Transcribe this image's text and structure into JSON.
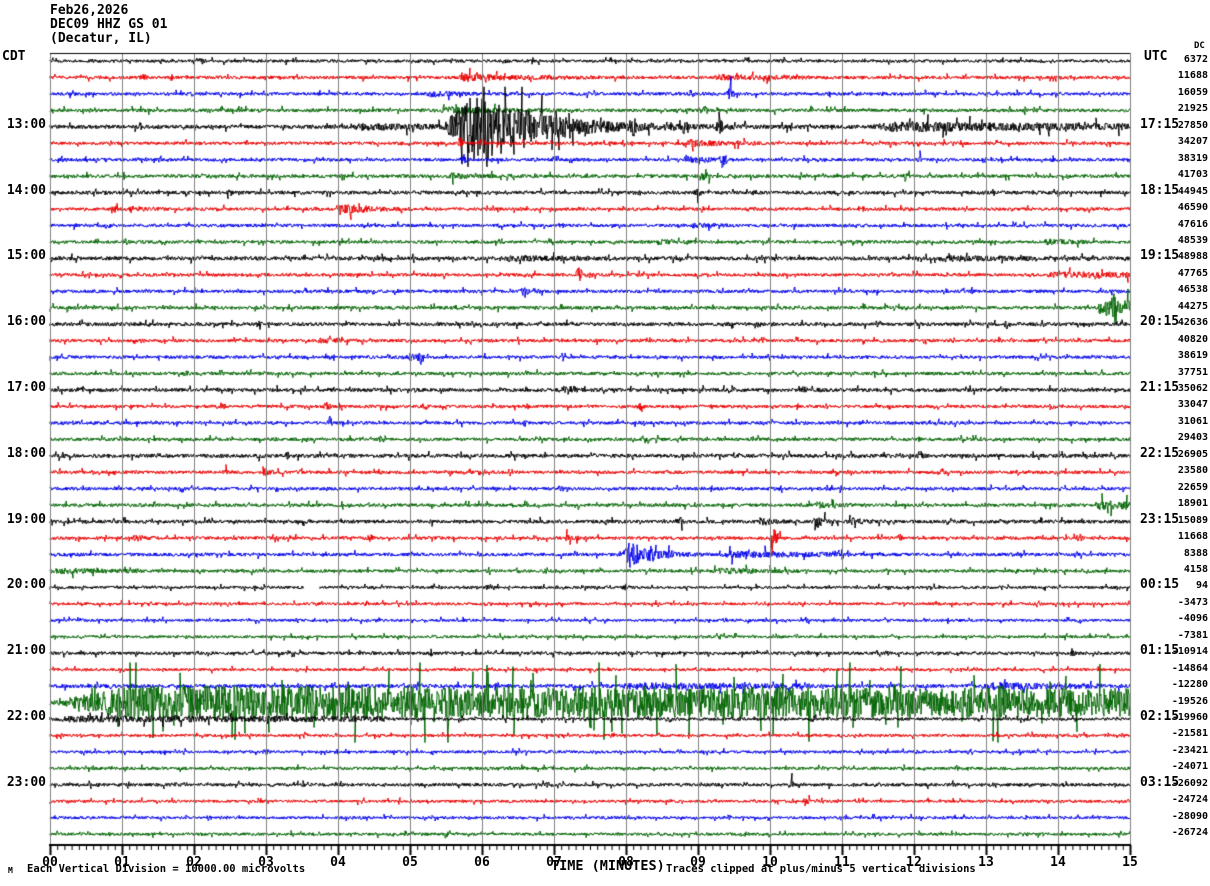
{
  "header": {
    "date": "Feb26,2026",
    "station": "DEC09 HHZ GS 01",
    "location": "(Decatur, IL)",
    "left_tz_label": "CDT",
    "right_tz_label": "UTC",
    "dc_column_header": "DC"
  },
  "footer": {
    "corner_glyph": "M",
    "scale_note": "Each Vertical Division = 10000.00 microvolts",
    "clip_note": "Traces clipped at plus/minus 5 vertical divisions"
  },
  "chart_data": {
    "type": "seismogram-helicorder",
    "title": "DEC09 HHZ GS 01 (Decatur, IL) Feb26,2026",
    "xlabel": "TIME (MINUTES)",
    "minutes_per_line": 15,
    "lines": 48,
    "xlim": [
      0,
      15
    ],
    "x_tick_labels": [
      "00",
      "01",
      "02",
      "03",
      "04",
      "05",
      "06",
      "07",
      "08",
      "09",
      "10",
      "11",
      "12",
      "13",
      "14",
      "15"
    ],
    "grid": true,
    "grid_color": "#808080",
    "colors_cycle": [
      "#000000",
      "#e80000",
      "#0000e8",
      "#006400"
    ],
    "clip_divisions": 5,
    "microvolts_per_division": 10000.0,
    "rows": [
      {
        "dc": 6372,
        "base": 1.5,
        "events": [],
        "spikes": [
          [
            2.1,
            2
          ],
          [
            6.3,
            2
          ]
        ]
      },
      {
        "dc": 11688,
        "base": 1.6,
        "events": [
          [
            5.6,
            7.7,
            2.5,
            0.8
          ],
          [
            9.2,
            10.8,
            2,
            0.8
          ]
        ],
        "spikes": [
          [
            1.3,
            2
          ]
        ]
      },
      {
        "dc": 16059,
        "base": 1.6,
        "events": [
          [
            5.2,
            6.4,
            2,
            1
          ]
        ],
        "spikes": [
          [
            9.45,
            7
          ],
          [
            8.9,
            3
          ]
        ]
      },
      {
        "dc": 21925,
        "base": 1.7,
        "events": [
          [
            5.4,
            7.3,
            2.5,
            1
          ]
        ],
        "spikes": [
          [
            9.1,
            3
          ],
          [
            0.6,
            2
          ]
        ]
      },
      {
        "cdt": "13:00",
        "utc": "17:15",
        "dc": 27850,
        "base": 1.9,
        "events": [
          [
            4.2,
            5.45,
            2,
            0.2
          ],
          [
            5.45,
            11.4,
            33,
            2.2
          ],
          [
            11.4,
            15,
            3.5,
            0.3
          ]
        ],
        "spikes": [
          [
            6.1,
            8
          ],
          [
            6.6,
            8
          ],
          [
            7.2,
            8
          ],
          [
            8.1,
            8
          ],
          [
            8.8,
            8
          ],
          [
            9.3,
            8
          ]
        ]
      },
      {
        "dc": 34207,
        "base": 1.6,
        "events": [
          [
            8.8,
            10.2,
            2.5,
            1
          ]
        ],
        "spikes": [
          [
            5.7,
            6
          ],
          [
            6.0,
            4
          ]
        ]
      },
      {
        "dc": 38319,
        "base": 1.6,
        "events": [
          [
            8.8,
            9.7,
            3,
            1
          ]
        ],
        "spikes": [
          [
            5.75,
            5
          ],
          [
            9.35,
            8
          ],
          [
            12.1,
            3
          ]
        ]
      },
      {
        "dc": 41703,
        "base": 1.7,
        "events": [
          [
            5.5,
            6.6,
            2,
            1
          ]
        ],
        "spikes": [
          [
            9.1,
            9
          ],
          [
            11.9,
            2
          ]
        ]
      },
      {
        "cdt": "14:00",
        "utc": "18:15",
        "dc": 44945,
        "base": 1.8,
        "events": [],
        "spikes": [
          [
            9.0,
            3
          ],
          [
            2.5,
            2
          ]
        ]
      },
      {
        "dc": 46590,
        "base": 1.6,
        "events": [
          [
            1.05,
            1.55,
            3,
            1
          ],
          [
            4.0,
            5.5,
            4.5,
            1.5
          ]
        ],
        "spikes": [
          [
            0.9,
            2.5
          ],
          [
            11.3,
            2
          ]
        ]
      },
      {
        "dc": 47616,
        "base": 1.6,
        "events": [
          [
            8.9,
            9.6,
            2,
            1
          ]
        ],
        "spikes": [
          [
            0.8,
            2.5
          ],
          [
            7.1,
            2
          ]
        ]
      },
      {
        "dc": 48539,
        "base": 1.6,
        "events": [
          [
            8.4,
            9.0,
            2,
            1
          ],
          [
            13.8,
            14.4,
            2,
            0.5
          ]
        ],
        "spikes": [
          [
            1.05,
            2.5
          ]
        ]
      },
      {
        "cdt": "15:00",
        "utc": "19:15",
        "dc": 48988,
        "base": 1.9,
        "events": [
          [
            6.3,
            7.5,
            1.5,
            0.3
          ],
          [
            12.3,
            13.6,
            1.5,
            0.3
          ]
        ],
        "spikes": []
      },
      {
        "dc": 47765,
        "base": 1.6,
        "events": [
          [
            13.8,
            15,
            1.5,
            0
          ]
        ],
        "spikes": [
          [
            7.35,
            8
          ],
          [
            7.5,
            4
          ]
        ]
      },
      {
        "dc": 46538,
        "base": 1.6,
        "events": [],
        "spikes": [
          [
            6.6,
            6
          ],
          [
            6.75,
            3
          ]
        ]
      },
      {
        "dc": 44275,
        "base": 1.7,
        "events": [
          [
            14.55,
            15,
            6,
            0
          ]
        ],
        "spikes": [
          [
            14.78,
            13
          ]
        ]
      },
      {
        "cdt": "16:00",
        "utc": "20:15",
        "dc": 42636,
        "base": 1.8,
        "events": [],
        "spikes": [
          [
            11.5,
            4
          ],
          [
            13.3,
            3
          ],
          [
            2.9,
            2
          ]
        ]
      },
      {
        "dc": 40820,
        "base": 1.6,
        "events": [
          [
            3.7,
            4.3,
            2,
            1
          ]
        ],
        "spikes": [
          [
            9.9,
            2.5
          ]
        ]
      },
      {
        "dc": 38619,
        "base": 1.6,
        "events": [
          [
            4.95,
            5.5,
            4,
            1.8
          ]
        ],
        "spikes": [
          [
            5.15,
            6
          ]
        ]
      },
      {
        "dc": 37751,
        "base": 1.6,
        "events": [],
        "spikes": [
          [
            1.9,
            2
          ]
        ]
      },
      {
        "cdt": "17:00",
        "utc": "21:15",
        "dc": 35062,
        "base": 1.8,
        "events": [
          [
            7.1,
            7.5,
            2.5,
            1
          ]
        ],
        "spikes": [
          [
            7.25,
            4
          ],
          [
            0.45,
            2.5
          ],
          [
            10.5,
            2
          ]
        ]
      },
      {
        "dc": 33047,
        "base": 1.6,
        "events": [],
        "spikes": [
          [
            3.85,
            4
          ],
          [
            5.2,
            3
          ],
          [
            8.2,
            3
          ],
          [
            13.9,
            3
          ],
          [
            2.4,
            2
          ]
        ]
      },
      {
        "dc": 31061,
        "base": 1.6,
        "events": [],
        "spikes": [
          [
            3.9,
            2.5
          ],
          [
            6.6,
            2.5
          ],
          [
            0.3,
            2
          ]
        ]
      },
      {
        "dc": 29403,
        "base": 1.6,
        "events": [],
        "spikes": [
          [
            8.25,
            3
          ],
          [
            4.6,
            2
          ]
        ]
      },
      {
        "cdt": "18:00",
        "utc": "22:15",
        "dc": 26905,
        "base": 1.9,
        "events": [],
        "spikes": [
          [
            2.9,
            2.5
          ],
          [
            3.3,
            2.5
          ],
          [
            12.1,
            2
          ]
        ]
      },
      {
        "dc": 23580,
        "base": 1.6,
        "events": [
          [
            2.95,
            3.4,
            2.5,
            1.5
          ]
        ],
        "spikes": [
          [
            2.45,
            2.5
          ],
          [
            12.4,
            2.5
          ]
        ]
      },
      {
        "dc": 22659,
        "base": 1.6,
        "events": [],
        "spikes": [
          [
            7.1,
            2
          ],
          [
            10.0,
            2
          ]
        ]
      },
      {
        "dc": 18901,
        "base": 1.7,
        "events": [
          [
            10.6,
            11.2,
            2.5,
            1
          ],
          [
            14.5,
            15,
            3,
            0
          ]
        ],
        "spikes": []
      },
      {
        "cdt": "19:00",
        "utc": "23:15",
        "dc": 15089,
        "base": 1.8,
        "events": [
          [
            9.85,
            10.3,
            3,
            1
          ],
          [
            10.6,
            10.95,
            8,
            1.2
          ],
          [
            11.1,
            11.6,
            2.5,
            1
          ]
        ],
        "spikes": [
          [
            8.75,
            4
          ]
        ]
      },
      {
        "dc": 11668,
        "base": 1.6,
        "events": [
          [
            1.15,
            1.5,
            3,
            1
          ],
          [
            7.15,
            7.6,
            3,
            1.5
          ]
        ],
        "spikes": [
          [
            10.05,
            8
          ],
          [
            10.1,
            5
          ],
          [
            4.45,
            2.5
          ],
          [
            11.8,
            3
          ],
          [
            14.3,
            3
          ]
        ]
      },
      {
        "dc": 8388,
        "base": 1.7,
        "events": [
          [
            7.95,
            9.3,
            12,
            1.6
          ],
          [
            9.3,
            11.2,
            2.5,
            0.5
          ]
        ],
        "spikes": [
          [
            8.35,
            4
          ],
          [
            8.6,
            4
          ]
        ]
      },
      {
        "dc": 4158,
        "base": 1.6,
        "events": [
          [
            0,
            1.2,
            1.5,
            0.3
          ],
          [
            9.2,
            10.4,
            2,
            0.5
          ]
        ],
        "spikes": [
          [
            6.9,
            2
          ]
        ]
      },
      {
        "cdt": "20:00",
        "utc": "00:15",
        "dc": 94,
        "base": 1.4,
        "events": [],
        "spikes": [
          [
            8.0,
            2.5
          ],
          [
            6.1,
            2
          ]
        ],
        "gaps": [
          [
            3.52,
            3.74
          ]
        ]
      },
      {
        "dc": -3473,
        "base": 1.4,
        "events": [],
        "spikes": [
          [
            4.4,
            2
          ]
        ]
      },
      {
        "dc": -4096,
        "base": 1.4,
        "events": [],
        "spikes": [
          [
            14.3,
            2.5
          ],
          [
            9.7,
            2
          ]
        ]
      },
      {
        "dc": -7381,
        "base": 1.4,
        "events": [],
        "spikes": [
          [
            9.3,
            2.5
          ]
        ]
      },
      {
        "cdt": "21:00",
        "utc": "01:15",
        "dc": -10914,
        "base": 1.6,
        "events": [],
        "spikes": [
          [
            14.2,
            2.5
          ],
          [
            5.3,
            2
          ]
        ]
      },
      {
        "dc": -14864,
        "base": 1.4,
        "events": [],
        "spikes": [
          [
            13.8,
            2.5
          ]
        ]
      },
      {
        "dc": -12280,
        "base": 1.9,
        "events": [
          [
            7.9,
            10.6,
            2,
            0.3
          ],
          [
            12.9,
            14.6,
            2.5,
            0.5
          ]
        ],
        "spikes": []
      },
      {
        "dc": -19526,
        "base": 2.5,
        "events": [
          [
            0.1,
            15,
            15,
            0.08
          ]
        ],
        "spikes": [
          [
            1.2,
            7
          ],
          [
            4.1,
            7
          ],
          [
            8.3,
            8
          ],
          [
            9.9,
            7
          ],
          [
            11.7,
            7
          ],
          [
            13.2,
            6
          ]
        ]
      },
      {
        "cdt": "22:00",
        "utc": "02:15",
        "dc": -19960,
        "base": 1.5,
        "events": [
          [
            0,
            4.7,
            2,
            0.1
          ]
        ],
        "spikes": [
          [
            8.6,
            2.5
          ],
          [
            10.6,
            2
          ]
        ]
      },
      {
        "dc": -21581,
        "base": 1.4,
        "events": [],
        "spikes": [
          [
            7.8,
            2
          ]
        ]
      },
      {
        "dc": -23421,
        "base": 1.4,
        "events": [],
        "spikes": [
          [
            3.0,
            2
          ]
        ]
      },
      {
        "dc": -24071,
        "base": 1.5,
        "events": [],
        "spikes": [
          [
            12.6,
            2
          ]
        ]
      },
      {
        "cdt": "23:00",
        "utc": "03:15",
        "dc": -26092,
        "base": 1.6,
        "events": [],
        "spikes": [
          [
            10.3,
            3
          ],
          [
            6.9,
            2
          ]
        ]
      },
      {
        "dc": -24724,
        "base": 1.4,
        "events": [],
        "spikes": [
          [
            10.5,
            3
          ]
        ]
      },
      {
        "dc": -28090,
        "base": 1.4,
        "events": [],
        "spikes": [
          [
            2.2,
            2
          ]
        ]
      },
      {
        "dc": -26724,
        "base": 1.4,
        "events": [],
        "spikes": [
          [
            5.5,
            2
          ]
        ]
      }
    ]
  }
}
